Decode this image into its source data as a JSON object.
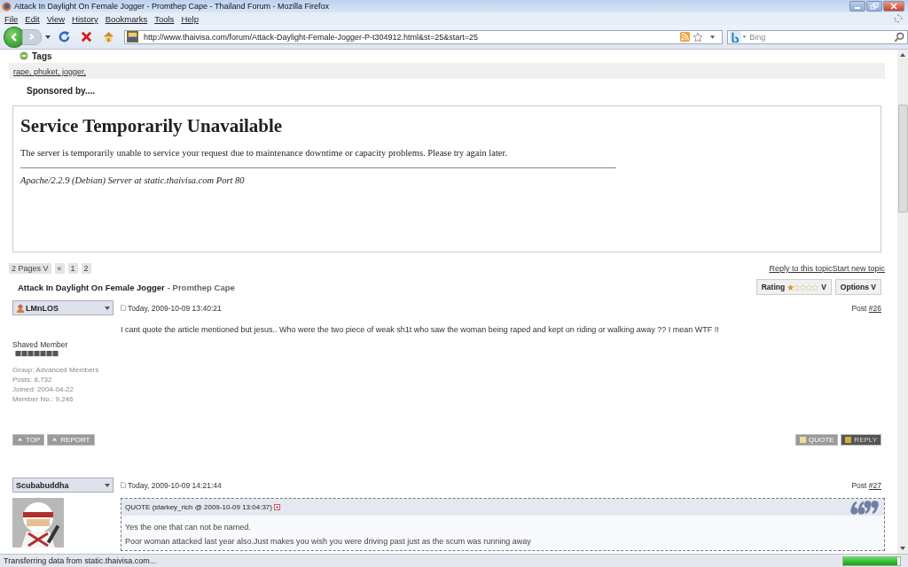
{
  "window": {
    "title": "Attack In Daylight On Female Jogger - Promthep Cape - Thailand Forum - Mozilla Firefox"
  },
  "menu": [
    "File",
    "Edit",
    "View",
    "History",
    "Bookmarks",
    "Tools",
    "Help"
  ],
  "toolbar": {
    "url": "http://www.thaivisa.com/forum/Attack-Daylight-Female-Jogger-P-t304912.html&st=25&start=25",
    "search_placeholder": "Bing"
  },
  "page": {
    "tags_heading": "Tags",
    "tags": "rape, phuket, jogger,",
    "sponsored": "Sponsored by....",
    "error": {
      "title": "Service Temporarily Unavailable",
      "message": "The server is temporarily unable to service your request due to maintenance downtime or capacity problems. Please try again later.",
      "address": "Apache/2.2.9 (Debian) Server at static.thaivisa.com Port 80"
    },
    "pagination": {
      "pages": "2 Pages V",
      "items": [
        "«",
        "1",
        "2"
      ]
    },
    "topic_links": [
      "Reply to this topic",
      "Start new topic"
    ],
    "topic": {
      "title": "Attack In Daylight On Female Jogger",
      "subtitle": "- Promthep Cape"
    },
    "rating": {
      "label": "Rating",
      "stars": 1,
      "caret": "V"
    },
    "options": "Options V",
    "posts": [
      {
        "author": "LMnLOS",
        "date": "Today, 2009-10-09 13:40:21",
        "post_label": "Post",
        "number": "#26",
        "body": "I cant quote the article mentioned but jesus.. Who were the two piece of weak sh1t who saw the woman being raped and kept on riding or walking away ?? I mean WTF !!",
        "member_title": "Shaved Member",
        "info": [
          "Group: Advanced Members",
          "Posts: 8,732",
          "Joined: 2004-04-22",
          "Member No.: 9,246"
        ],
        "left_actions": [
          "TOP",
          "REPORT"
        ],
        "right_actions": [
          "QUOTE",
          "REPLY"
        ]
      },
      {
        "author": "Scubabuddha",
        "date": "Today, 2009-10-09 14:21:44",
        "post_label": "Post",
        "number": "#27",
        "quote": {
          "header": "QUOTE (starkey_rich @ 2009-10-09 13:04:37)",
          "lines": [
            "Yes the one that can not be named.",
            "Poor woman attacked last year also.Just makes you wish you were driving past just as the scum was running away"
          ]
        }
      }
    ]
  },
  "status_bar": {
    "text": "Transferring data from static.thaivisa.com...",
    "level": 0.95
  }
}
